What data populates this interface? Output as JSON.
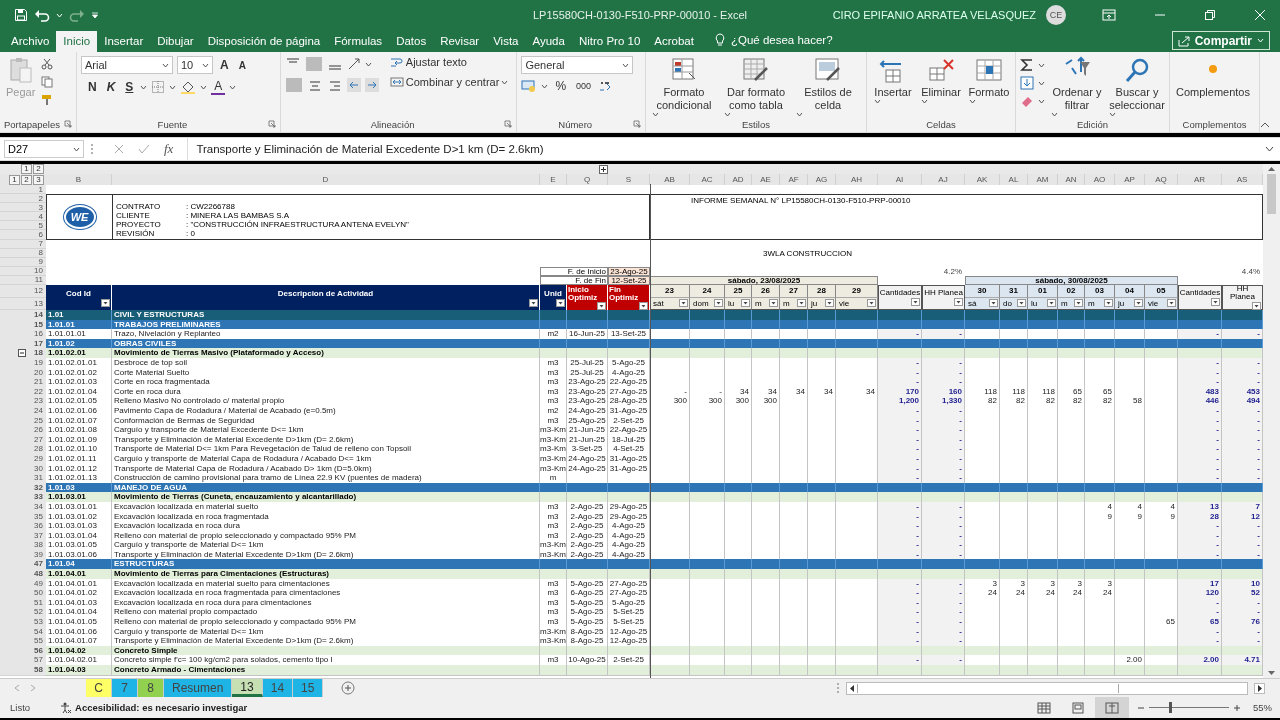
{
  "window": {
    "title": "LP15580CH-0130-F510-PRP-00010  -  Excel",
    "user": "CIRO EPIFANIO ARRATEA VELASQUEZ",
    "avatar": "CE"
  },
  "menu": {
    "tabs": [
      {
        "label": "Archivo",
        "selected": false
      },
      {
        "label": "Inicio",
        "selected": true
      },
      {
        "label": "Insertar",
        "selected": false
      },
      {
        "label": "Dibujar",
        "selected": false
      },
      {
        "label": "Disposición de página",
        "selected": false
      },
      {
        "label": "Fórmulas",
        "selected": false
      },
      {
        "label": "Datos",
        "selected": false
      },
      {
        "label": "Revisar",
        "selected": false
      },
      {
        "label": "Vista",
        "selected": false
      },
      {
        "label": "Ayuda",
        "selected": false
      },
      {
        "label": "Nitro Pro 10",
        "selected": false
      },
      {
        "label": "Acrobat",
        "selected": false
      }
    ],
    "search": "¿Qué desea hacer?",
    "share": "Compartir"
  },
  "ribbon": {
    "clipboard": {
      "label": "Portapapeles",
      "paste": "Pegar"
    },
    "font": {
      "label": "Fuente",
      "family": "Arial",
      "size": "10",
      "grow": "A",
      "shrink": "A",
      "bold": "N",
      "italic": "K",
      "underline": "S",
      "text_tool": "A"
    },
    "alignment": {
      "label": "Alineación",
      "wrap": "Ajustar texto",
      "merge": "Combinar y centrar"
    },
    "number": {
      "label": "Número",
      "format": "General",
      "percent": "%",
      "thousands": "000"
    },
    "styles": {
      "label": "Estilos",
      "buttons": [
        "Formato condicional",
        "Dar formato como tabla",
        "Estilos de celda"
      ]
    },
    "cells": {
      "label": "Celdas",
      "buttons": [
        "Insertar",
        "Eliminar",
        "Formato"
      ]
    },
    "editing": {
      "label": "Edición",
      "buttons": [
        "Ordenar y filtrar",
        "Buscar y seleccionar"
      ]
    },
    "addins": {
      "label": "Complementos",
      "buttons": [
        "Complementos"
      ]
    }
  },
  "formula_bar": {
    "name_box": "D27",
    "function_label": "fx",
    "formula": "Transporte y Eliminación de Material Excedente D>1 km (D= 2.6km)"
  },
  "sheet": {
    "row_levels": [
      "1",
      "2",
      "3"
    ],
    "column_levels": [
      "1",
      "2"
    ],
    "columns": [
      "B",
      "D",
      "E",
      "Q",
      "S",
      "AB",
      "AC",
      "AD",
      "AE",
      "AF",
      "AG",
      "AH",
      "AI",
      "AJ",
      "AK",
      "AL",
      "AM",
      "AN",
      "AO",
      "AP",
      "AQ",
      "AR",
      "AS"
    ],
    "header_rows": [
      "1",
      "2",
      "3",
      "4",
      "5",
      "6",
      "7",
      "8",
      "9",
      "10",
      "11",
      "12",
      "13"
    ],
    "logo": "WE",
    "info": [
      {
        "label": "CONTRATO",
        "value": ": CW2266788"
      },
      {
        "label": "CLIENTE",
        "value": ": MINERA LAS BAMBAS S.A"
      },
      {
        "label": "PROYECTO",
        "value": ": \"CONSTRUCCIÓN INFRAESTRUCTURA ANTENA EVELYN\""
      },
      {
        "label": "REVISIÓN",
        "value": ": 0"
      }
    ],
    "report_title": "INFORME SEMANAL N° LP15580CH-0130-F510-PRP-00010",
    "subtitle": "3WLA CONSTRUCCION",
    "start_label": "F. de Inicio",
    "start_date": "23-Ago-25",
    "end_label": "F. de Fin",
    "end_date": "12-Set-25",
    "headers": {
      "code": "Cod Id",
      "desc": "Descripcion de Actividad",
      "unit": "Unid",
      "start": "Inicio Optimiz",
      "end": "Fin Optimiz"
    },
    "weeks": [
      {
        "label": "sábado, 23/08/2025",
        "color": "#eeece1",
        "percent": "4.2%",
        "qty_label": "Cantidades",
        "hh_label": "HH Planea",
        "days": [
          {
            "num": "23",
            "name": "sát"
          },
          {
            "num": "24",
            "name": "dom"
          },
          {
            "num": "25",
            "name": "lu"
          },
          {
            "num": "26",
            "name": "m"
          },
          {
            "num": "27",
            "name": "m"
          },
          {
            "num": "28",
            "name": "ju"
          },
          {
            "num": "29",
            "name": "vie"
          }
        ]
      },
      {
        "label": "sábado, 30/08/2025",
        "color": "#dce6f1",
        "percent": "4.4%",
        "qty_label": "Cantidades",
        "hh_label": "HH Planea",
        "days": [
          {
            "num": "30",
            "name": "sá"
          },
          {
            "num": "31",
            "name": "do"
          },
          {
            "num": "01",
            "name": "lu"
          },
          {
            "num": "02",
            "name": "m"
          },
          {
            "num": "03",
            "name": "m"
          },
          {
            "num": "04",
            "name": "ju"
          },
          {
            "num": "05",
            "name": "vie"
          }
        ]
      }
    ],
    "rows": [
      {
        "n": "14",
        "kind": "l1",
        "code": "1.01",
        "desc": "CIVIL Y ESTRUCTURAS"
      },
      {
        "n": "15",
        "kind": "l2",
        "code": "1.01.01",
        "desc": "TRABAJOS PRELIMINARES"
      },
      {
        "n": "16",
        "kind": "item",
        "code": "1.01.01.01",
        "desc": "Trazo, Nivelación y Replanteo",
        "unit": "m2",
        "start": "16-Jun-25",
        "end": "13-Set-25",
        "q1": "-",
        "h1": "-",
        "q2": "-",
        "h2": "-"
      },
      {
        "n": "17",
        "kind": "l2",
        "code": "1.01.02",
        "desc": "OBRAS CIVILES"
      },
      {
        "n": "18",
        "kind": "l3",
        "code": "1.01.02.01",
        "desc": "Movimiento de Tierras Masivo (Plataformado y Acceso)",
        "collapse_button": true
      },
      {
        "n": "19",
        "kind": "item",
        "code": "1.01.02.01.01",
        "desc": "Desbroce de top soil",
        "unit": "m3",
        "start": "25-Jul-25",
        "end": "5-Ago-25",
        "q1": "-",
        "h1": "-",
        "q2": "-",
        "h2": "-"
      },
      {
        "n": "20",
        "kind": "item",
        "code": "1.01.02.01.02",
        "desc": "Corte Material Suelto",
        "unit": "m3",
        "start": "25-Jul-25",
        "end": "4-Ago-25",
        "q1": "-",
        "h1": "-",
        "q2": "-",
        "h2": "-"
      },
      {
        "n": "21",
        "kind": "item",
        "code": "1.01.02.01.03",
        "desc": "Corte en roca fragmentada",
        "unit": "m3",
        "start": "23-Ago-25",
        "end": "22-Ago-25",
        "q1": "-",
        "h1": "-",
        "q2": "-",
        "h2": "-"
      },
      {
        "n": "22",
        "kind": "item",
        "code": "1.01.02.01.04",
        "desc": "Corte en roca dura",
        "unit": "m3",
        "start": "23-Ago-25",
        "end": "27-Ago-25",
        "w1": {
          "d1": "-",
          "d2": "-",
          "d3": "34",
          "d4": "34",
          "d5": "34",
          "d6": "34",
          "d7": "34"
        },
        "q1": "170",
        "h1": "160",
        "w2": {
          "d1": "118",
          "d2": "118",
          "d3": "118",
          "d4": "65",
          "d5": "65"
        },
        "q2": "483",
        "h2": "453"
      },
      {
        "n": "23",
        "kind": "item",
        "code": "1.01.02.01.05",
        "desc": "Relleno Masivo No controlado c/ material propio",
        "unit": "m3",
        "start": "23-Ago-25",
        "end": "28-Ago-25",
        "w1": {
          "d1": "300",
          "d2": "300",
          "d3": "300",
          "d4": "300"
        },
        "q1": "1,200",
        "h1": "1,330",
        "w2": {
          "d1": "82",
          "d2": "82",
          "d3": "82",
          "d4": "82",
          "d5": "82",
          "d6": "58"
        },
        "q2": "446",
        "h2": "494"
      },
      {
        "n": "24",
        "kind": "item",
        "code": "1.01.02.01.06",
        "desc": "Pavimento Capa de Rodadura / Material de Acabado (e=0.5m)",
        "unit": "m2",
        "start": "24-Ago-25",
        "end": "31-Ago-25",
        "q1": "-",
        "h1": "-",
        "q2": "-",
        "h2": "-"
      },
      {
        "n": "25",
        "kind": "item",
        "code": "1.01.02.01.07",
        "desc": "Conformación de Bermas de Seguridad",
        "unit": "m3",
        "start": "25-Ago-25",
        "end": "2-Set-25",
        "q1": "-",
        "h1": "-",
        "q2": "-",
        "h2": "-"
      },
      {
        "n": "26",
        "kind": "item",
        "code": "1.01.02.01.08",
        "desc": "Carguío y transporte de Material Excedente D<= 1km",
        "unit": "m3-Km",
        "start": "21-Jun-25",
        "end": "22-Ago-25",
        "q1": "-",
        "h1": "-",
        "q2": "-",
        "h2": "-"
      },
      {
        "n": "27",
        "kind": "item",
        "code": "1.01.02.01.09",
        "desc": "Transporte y Eliminación de Material Excedente D>1km (D= 2.6km)",
        "unit": "m3-Km",
        "start": "21-Jun-25",
        "end": "18-Jul-25",
        "q1": "-",
        "h1": "-",
        "q2": "-",
        "h2": "-"
      },
      {
        "n": "28",
        "kind": "item",
        "code": "1.01.02.01.10",
        "desc": "Transporte de Material D<= 1km Para Revegetación de Talud de relleno con Topsoil",
        "unit": "m3-Km",
        "start": "3-Set-25",
        "end": "4-Set-25",
        "q1": "-",
        "h1": "-",
        "q2": "-",
        "h2": "-"
      },
      {
        "n": "29",
        "kind": "item",
        "code": "1.01.02.01.11",
        "desc": "Carguío y transporte de Material Capa de Rodadura / Acabado D<= 1km",
        "unit": "m3-Km",
        "start": "24-Ago-25",
        "end": "31-Ago-25",
        "q1": "-",
        "h1": "-",
        "q2": "-",
        "h2": "-"
      },
      {
        "n": "30",
        "kind": "item",
        "code": "1.01.02.01.12",
        "desc": "Transporte de Material Capa de Rodadura / Acabado D> 1km (D=5.0km)",
        "unit": "m3-Km",
        "start": "24-Ago-25",
        "end": "31-Ago-25",
        "q1": "-",
        "h1": "-",
        "q2": "-",
        "h2": "-"
      },
      {
        "n": "31",
        "kind": "item",
        "code": "1.01.02.01.13",
        "desc": "Construcción de camino provisional para tramo de Línea 22.9 KV (puentes de madera)",
        "unit": "m",
        "q1": "-",
        "h1": "-",
        "q2": "-",
        "h2": "-"
      },
      {
        "n": "32",
        "kind": "l2",
        "code": "1.01.03",
        "desc": "MANEJO DE AGUA"
      },
      {
        "n": "33",
        "kind": "l3",
        "code": "1.01.03.01",
        "desc": "Movimiento de Tierras (Cuneta, encauzamiento y alcantarillado)"
      },
      {
        "n": "34",
        "kind": "item",
        "code": "1.01.03.01.01",
        "desc": "Excavación localizada en material suelto",
        "unit": "m3",
        "start": "2-Ago-25",
        "end": "29-Ago-25",
        "q1": "-",
        "h1": "-",
        "w2": {
          "d5": "4",
          "d6": "4",
          "d7": "4"
        },
        "q2": "13",
        "h2": "7"
      },
      {
        "n": "35",
        "kind": "item",
        "code": "1.01.03.01.02",
        "desc": "Excavación localizada en roca fragmentada",
        "unit": "m3",
        "start": "2-Ago-25",
        "end": "29-Ago-25",
        "q1": "-",
        "h1": "-",
        "w2": {
          "d5": "9",
          "d6": "9",
          "d7": "9"
        },
        "q2": "28",
        "h2": "12"
      },
      {
        "n": "36",
        "kind": "item",
        "code": "1.01.03.01.03",
        "desc": "Excavación localizada en roca dura",
        "unit": "m3",
        "start": "2-Ago-25",
        "end": "4-Ago-25",
        "q1": "-",
        "h1": "-",
        "q2": "-",
        "h2": "-"
      },
      {
        "n": "37",
        "kind": "item",
        "code": "1.01.03.01.04",
        "desc": "Relleno con material de propio seleccionado y compactado 95% PM",
        "unit": "m3",
        "start": "2-Ago-25",
        "end": "4-Ago-25",
        "q1": "-",
        "h1": "-",
        "q2": "-",
        "h2": "-"
      },
      {
        "n": "38",
        "kind": "item",
        "code": "1.01.03.01.05",
        "desc": "Carguío y transporte de Material D<= 1km",
        "unit": "m3-Km",
        "start": "2-Ago-25",
        "end": "4-Ago-25",
        "q1": "-",
        "h1": "-",
        "q2": "-",
        "h2": "-"
      },
      {
        "n": "39",
        "kind": "item",
        "code": "1.01.03.01.06",
        "desc": "Transporte y Eliminación de Material Excedente D>1km (D= 2.6km)",
        "unit": "m3-Km",
        "start": "2-Ago-25",
        "end": "4-Ago-25",
        "q1": "-",
        "h1": "-",
        "q2": "-",
        "h2": "-"
      },
      {
        "n": "47",
        "kind": "l2",
        "code": "1.01.04",
        "desc": "ESTRUCTURAS"
      },
      {
        "n": "48",
        "kind": "l3",
        "code": "1.01.04.01",
        "desc": "Movimiento de Tierras para Cimentaciones (Estructuras)"
      },
      {
        "n": "49",
        "kind": "item",
        "code": "1.01.04.01.01",
        "desc": "Excavación localizada en material suelto para cimentaciones",
        "unit": "m3",
        "start": "5-Ago-25",
        "end": "27-Ago-25",
        "q1": "-",
        "h1": "-",
        "w2": {
          "d1": "3",
          "d2": "3",
          "d3": "3",
          "d4": "3",
          "d5": "3"
        },
        "q2": "17",
        "h2": "10"
      },
      {
        "n": "50",
        "kind": "item",
        "code": "1.01.04.01.02",
        "desc": "Excavación localizada en roca fragmentada para cimentaciones",
        "unit": "m3",
        "start": "6-Ago-25",
        "end": "27-Ago-25",
        "q1": "-",
        "h1": "-",
        "w2": {
          "d1": "24",
          "d2": "24",
          "d3": "24",
          "d4": "24",
          "d5": "24"
        },
        "q2": "120",
        "h2": "52"
      },
      {
        "n": "51",
        "kind": "item",
        "code": "1.01.04.01.03",
        "desc": "Excavación localizada en roca dura para cimentaciones",
        "unit": "m3",
        "start": "5-Ago-25",
        "end": "5-Ago-25",
        "q1": "-",
        "h1": "-",
        "q2": "-",
        "h2": "-"
      },
      {
        "n": "52",
        "kind": "item",
        "code": "1.01.04.01.04",
        "desc": "Relleno con material propio compactado",
        "unit": "m3",
        "start": "5-Ago-25",
        "end": "5-Set-25",
        "q1": "-",
        "h1": "-",
        "q2": "-",
        "h2": "-"
      },
      {
        "n": "53",
        "kind": "item",
        "code": "1.01.04.01.05",
        "desc": "Relleno con material de propio seleccionado y compactado 95% PM",
        "unit": "m3",
        "start": "5-Ago-25",
        "end": "5-Set-25",
        "q1": "-",
        "h1": "-",
        "w2": {
          "d7": "65"
        },
        "q2": "65",
        "h2": "76"
      },
      {
        "n": "54",
        "kind": "item",
        "code": "1.01.04.01.06",
        "desc": "Carguío y transporte de Material D<= 1km",
        "unit": "m3-Km",
        "start": "8-Ago-25",
        "end": "12-Ago-25",
        "q1": "-",
        "h1": "-",
        "q2": "-",
        "h2": "-"
      },
      {
        "n": "55",
        "kind": "item",
        "code": "1.01.04.01.07",
        "desc": "Transporte y Eliminación de Material Excedente D>1km (D= 2.6km)",
        "unit": "m3-Km",
        "start": "8-Ago-25",
        "end": "12-Ago-25",
        "q1": "-",
        "h1": "-",
        "q2": "-",
        "h2": "-"
      },
      {
        "n": "56",
        "kind": "l3",
        "code": "1.01.04.02",
        "desc": "Concreto Simple"
      },
      {
        "n": "57",
        "kind": "item",
        "code": "1.01.04.02.01",
        "desc": "Concreto simple f'c= 100 kg/cm2 para solados, cemento tipo I",
        "unit": "m3",
        "start": "10-Ago-25",
        "end": "2-Set-25",
        "q1": "-",
        "h1": "-",
        "w2": {
          "d6": "2.00"
        },
        "q2": "2.00",
        "h2": "4.71"
      },
      {
        "n": "58",
        "kind": "l3",
        "code": "1.01.04.03",
        "desc": "Concreto Armado - Cimentaciones"
      }
    ]
  },
  "sheet_tabs": [
    {
      "label": "C",
      "color": "#ffff66",
      "selected": false
    },
    {
      "label": "7",
      "color": "#1fb4e6",
      "selected": false
    },
    {
      "label": "8",
      "color": "#92d050",
      "selected": false
    },
    {
      "label": "Resumen",
      "color": "#1fb4e6",
      "selected": false
    },
    {
      "label": "13",
      "color": "#c6e0b4",
      "selected": true
    },
    {
      "label": "14",
      "color": "#1fb4e6",
      "selected": false
    },
    {
      "label": "15",
      "color": "#1fb4e6",
      "selected": false
    }
  ],
  "status_bar": {
    "ready": "Listo",
    "accessibility": "Accesibilidad: es necesario investigar",
    "views": [
      {
        "selected": false
      },
      {
        "selected": false
      },
      {
        "selected": true
      }
    ],
    "zoom": "55%",
    "zoom_slider": {
      "level": 0.25
    }
  }
}
